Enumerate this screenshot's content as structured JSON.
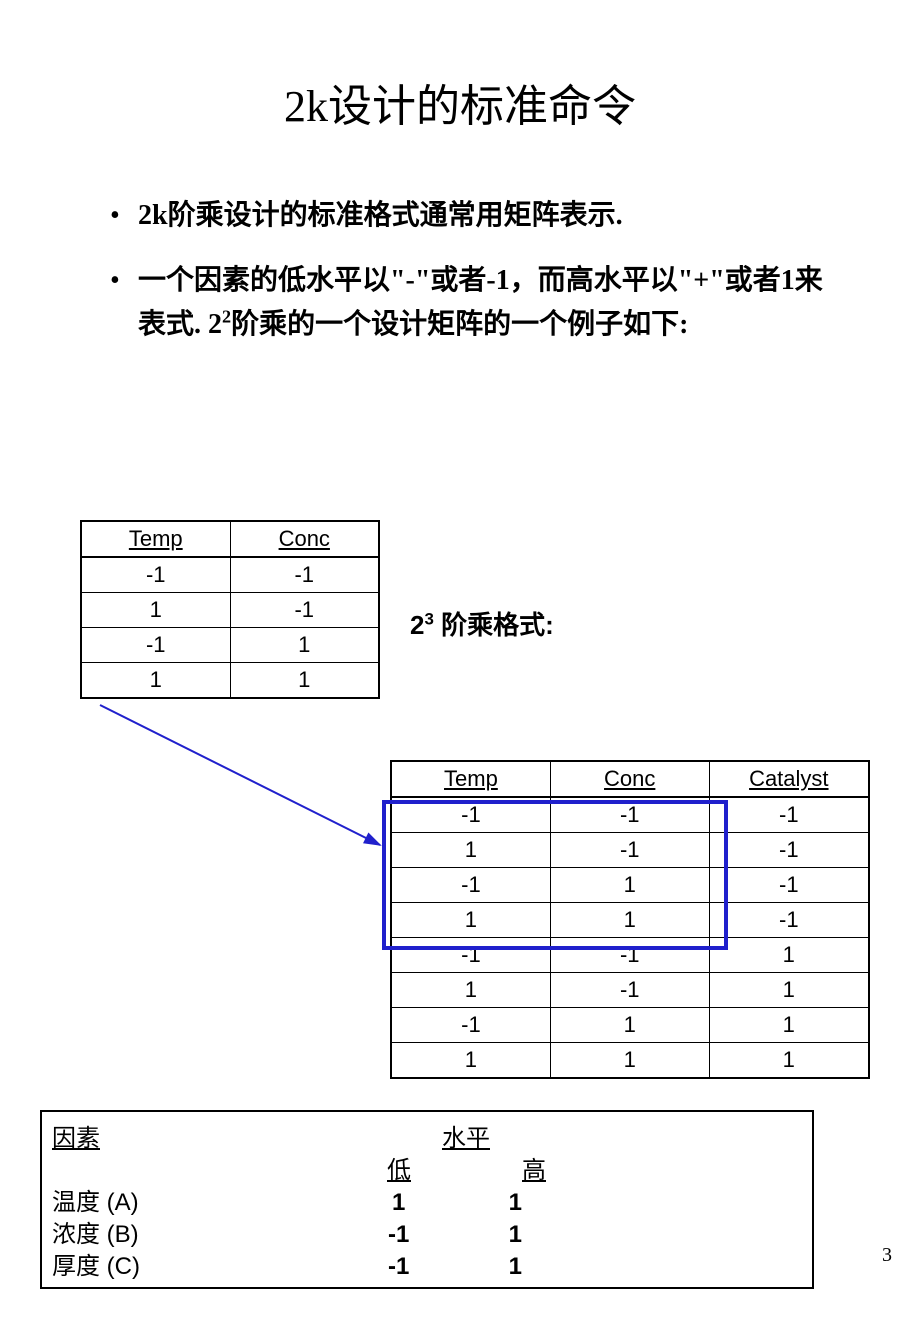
{
  "title": "2k设计的标准命令",
  "bullets": {
    "b1_html_pre": "2k",
    "b1_rest": "阶乘设计的标准格式通常用矩阵表示.",
    "b2_part1": "一个因素的低水平以\"-\"或者-1，而高水平以\"+\"或者1来表式. 2",
    "b2_sup": "2",
    "b2_part2": "阶乘的一个设计矩阵的一个例子如下:"
  },
  "label23_pre": "2",
  "label23_sup": "3",
  "label23_post": " 阶乘格式:",
  "table1": {
    "headers": [
      "Temp",
      "Conc"
    ],
    "rows": [
      [
        "-1",
        "-1"
      ],
      [
        "1",
        "-1"
      ],
      [
        "-1",
        "1"
      ],
      [
        "1",
        "1"
      ]
    ]
  },
  "table2": {
    "headers": [
      "Temp",
      "Conc",
      "Catalyst"
    ],
    "rows": [
      [
        "-1",
        "-1",
        "-1"
      ],
      [
        "1",
        "-1",
        "-1"
      ],
      [
        "-1",
        "1",
        "-1"
      ],
      [
        "1",
        "1",
        "-1"
      ],
      [
        "-1",
        "-1",
        "1"
      ],
      [
        "1",
        "-1",
        "1"
      ],
      [
        "-1",
        "1",
        "1"
      ],
      [
        "1",
        "1",
        "1"
      ]
    ]
  },
  "factors": {
    "hdr_factor": "因素",
    "hdr_level": "水平",
    "hdr_low": "低",
    "hdr_high": "高",
    "rows": [
      {
        "name": "温度 (A)",
        "low": "1",
        "high": "1"
      },
      {
        "name": "浓度 (B)",
        "low": "-1",
        "high": "1"
      },
      {
        "name": "厚度 (C)",
        "low": "-1",
        "high": "1"
      }
    ]
  },
  "page_number": "3"
}
